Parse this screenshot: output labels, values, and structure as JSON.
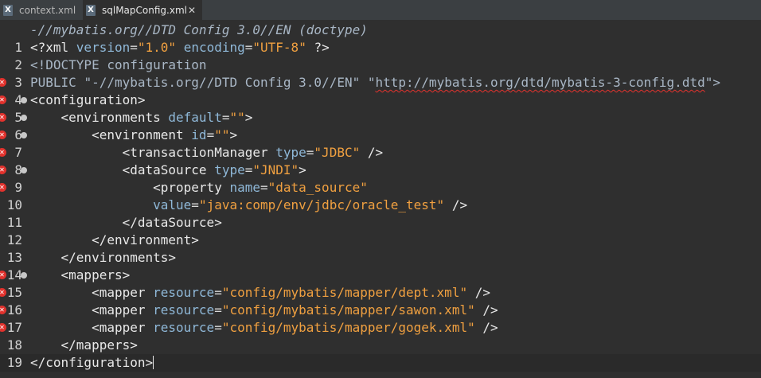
{
  "tabs": [
    {
      "label": "context.xml",
      "active": false
    },
    {
      "label": "sqlMapConfig.xml",
      "active": true
    }
  ],
  "editor": {
    "tooltip": "-//mybatis.org//DTD Config 3.0//EN (doctype)",
    "line_numbers": [
      "1",
      "2",
      "3",
      "4",
      "5",
      "6",
      "7",
      "8",
      "9",
      "10",
      "11",
      "12",
      "13",
      "14",
      "15",
      "16",
      "17",
      "18",
      "19"
    ],
    "code": {
      "l1": {
        "open": "<?xml ",
        "a1": "version",
        "eq1": "=",
        "v1": "\"1.0\"",
        "sp": " ",
        "a2": "encoding",
        "eq2": "=",
        "v2": "\"UTF-8\"",
        "close": " ?>"
      },
      "l2": {
        "open": "<!DOCTYPE ",
        "name": "configuration"
      },
      "l3": {
        "kw": "PUBLIC ",
        "pub": "\"-//mybatis.org//DTD Config 3.0//EN\"",
        "sp": " ",
        "q1": "\"",
        "url": "http://mybatis.org/dtd/mybatis-3-config.dtd",
        "q2": "\"",
        "close": ">"
      },
      "l4": {
        "text": "<configuration>"
      },
      "l5": {
        "open": "<environments ",
        "attr": "default",
        "eq": "=",
        "val": "\"\"",
        "close": ">"
      },
      "l6": {
        "open": "<environment ",
        "attr": "id",
        "eq": "=",
        "val": "\"\"",
        "close": ">"
      },
      "l7": {
        "open": "<transactionManager ",
        "attr": "type",
        "eq": "=",
        "val": "\"JDBC\"",
        "close": " />"
      },
      "l8": {
        "open": "<dataSource ",
        "attr": "type",
        "eq": "=",
        "val": "\"JNDI\"",
        "close": ">"
      },
      "l9": {
        "open": "<property ",
        "attr": "name",
        "eq": "=",
        "val": "\"data_source\""
      },
      "l10": {
        "attr": "value",
        "eq": "=",
        "val": "\"java:comp/env/jdbc/oracle_test\"",
        "close": " />"
      },
      "l11": {
        "text": "</dataSource>"
      },
      "l12": {
        "text": "</environment>"
      },
      "l13": {
        "text": "</environments>"
      },
      "l14": {
        "text": "<mappers>"
      },
      "l15": {
        "open": "<mapper ",
        "attr": "resource",
        "eq": "=",
        "val": "\"config/mybatis/mapper/dept.xml\"",
        "close": " />"
      },
      "l16": {
        "open": "<mapper ",
        "attr": "resource",
        "eq": "=",
        "val": "\"config/mybatis/mapper/sawon.xml\"",
        "close": " />"
      },
      "l17": {
        "open": "<mapper ",
        "attr": "resource",
        "eq": "=",
        "val": "\"config/mybatis/mapper/gogek.xml\"",
        "close": " />"
      },
      "l18": {
        "text": "</mappers>"
      },
      "l19": {
        "text": "</configuration>"
      }
    }
  }
}
